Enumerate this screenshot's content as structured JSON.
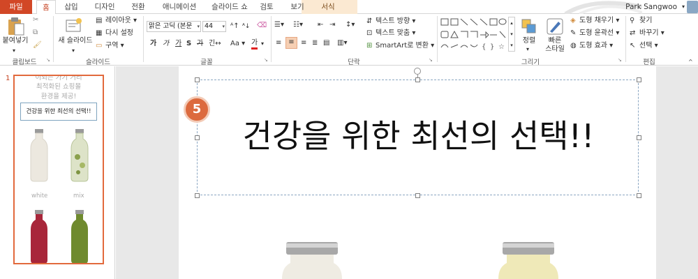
{
  "tabs": [
    "파일",
    "홈",
    "삽입",
    "디자인",
    "전환",
    "애니메이션",
    "슬라이드 쇼",
    "검토",
    "보기",
    "서식"
  ],
  "user": {
    "name": "Park Sangwoo"
  },
  "ribbon": {
    "clipboard": {
      "paste": "붙여넣기",
      "label": "클립보드"
    },
    "slides": {
      "new_slide": "새 슬라이드",
      "layout": "레이아웃",
      "reset": "다시 설정",
      "section": "구역",
      "label": "슬라이드"
    },
    "font": {
      "font_name": "맑은 고딕 (본문",
      "font_size": "44",
      "label": "글꼴",
      "change_case": "Aa"
    },
    "paragraph": {
      "text_direction": "텍스트 방향",
      "align_text": "텍스트 맞춤",
      "smartart": "SmartArt로 변환",
      "label": "단락"
    },
    "drawing": {
      "arrange": "정렬",
      "quick_styles": "빠른\n스타일",
      "quick_styles_l1": "빠른",
      "quick_styles_l2": "스타일",
      "shape_fill": "도형 채우기",
      "shape_outline": "도형 윤곽선",
      "shape_effects": "도형 효과",
      "label": "그리기"
    },
    "editing": {
      "find": "찾기",
      "replace": "바꾸기",
      "select": "선택",
      "label": "편집"
    }
  },
  "thumbnail": {
    "slide_number": "1",
    "line1": "이되는 가기 거리",
    "line2": "최적화된 쇼핑몰",
    "line3": "환경을 제공!",
    "box_text": "건강을 위한 최선의 선택!!",
    "labels": [
      "white",
      "mix"
    ]
  },
  "slide": {
    "badge": "5",
    "title": "건강을 위한 최선의 선택!!"
  },
  "colors": {
    "accent": "#d24726",
    "badge": "#dc6a3e",
    "selection": "#e2693c"
  }
}
